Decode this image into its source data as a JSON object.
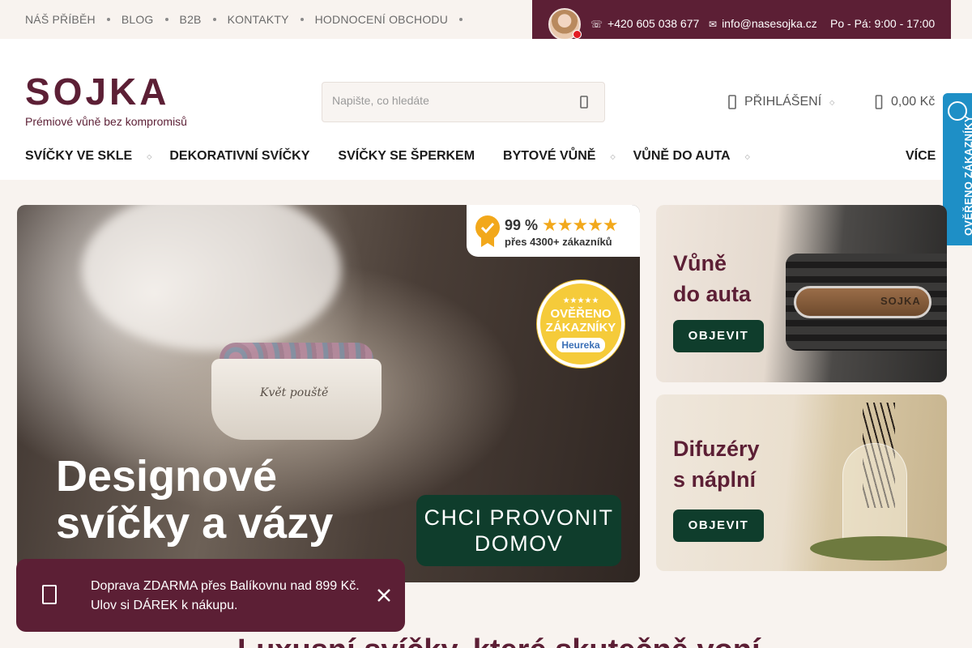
{
  "topbar": {
    "links": [
      "NÁŠ PŘÍBĚH",
      "BLOG",
      "B2B",
      "KONTAKTY",
      "HODNOCENÍ OBCHODU"
    ],
    "phone": "+420 605 038 677",
    "email": "info@nasesojka.cz",
    "hours": "Po - Pá: 9:00 - 17:00"
  },
  "header": {
    "logo_text": "SOJKA",
    "tagline": "Prémiové vůně bez kompromisů",
    "search_placeholder": "Napište, co hledáte",
    "login_label": "PŘIHLÁŠENÍ",
    "cart_total": "0,00 Kč"
  },
  "nav": {
    "items": [
      "SVÍČKY VE SKLE",
      "DEKORATIVNÍ SVÍČKY",
      "SVÍČKY SE ŠPERKEM",
      "BYTOVÉ VŮNĚ",
      "VŮNĚ DO AUTA"
    ],
    "more": "VÍCE"
  },
  "verified_badge": {
    "label": "OVĚŘENO ZÁKAZNÍKY"
  },
  "hero": {
    "headline_line1": "Designové",
    "headline_line2": "svíčky a vázy",
    "cta_line1": "CHCI PROVONIT",
    "cta_line2": "DOMOV",
    "rating_percent": "99 %",
    "rating_stars": "★★★★★",
    "rating_customers": "přes 4300+ zákazníků",
    "heureka_line1": "OVĚŘENO",
    "heureka_line2": "ZÁKAZNÍKY",
    "heureka_brand": "Heureka",
    "candle_label": "Květ pouště"
  },
  "banners": [
    {
      "title_line1": "Vůně",
      "title_line2": "do auta",
      "button": "OBJEVIT",
      "product_mark": "SOJKA"
    },
    {
      "title_line1": "Difuzéry",
      "title_line2": "s náplní",
      "button": "OBJEVIT"
    }
  ],
  "toast": {
    "line1": "Doprava ZDARMA přes Balíkovnu nad 899 Kč.",
    "line2": "Ulov si DÁREK k nákupu."
  },
  "section_heading": "Luxusní svíčky, které skutečně voní"
}
